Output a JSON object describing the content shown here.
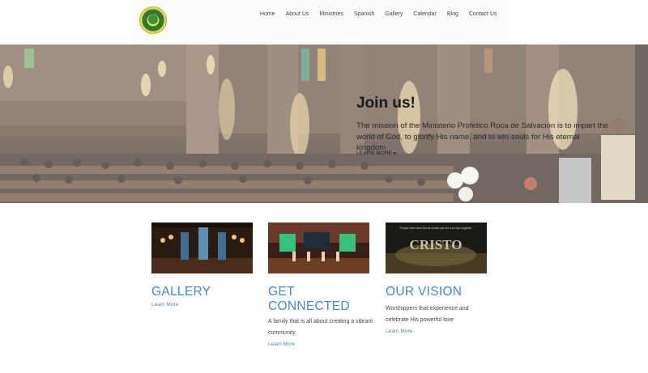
{
  "nav": {
    "items": [
      "Home",
      "About Us",
      "Ministries",
      "Spanish",
      "Gallery",
      "Calendar",
      "Blog",
      "Contact Us"
    ]
  },
  "hero": {
    "title": "Join us!",
    "text": "The mission of the Ministerio Profetico Roca de Salvacion is to impart the world of God, to glorify His name, and to win souls for His eternal kingdom",
    "link": "LEARN MORE ▸"
  },
  "cards": [
    {
      "title": "GALLERY",
      "text": "",
      "link": "Learn More"
    },
    {
      "title": "GET CONNECTED",
      "text": "A family that is all about creating a vibrant community",
      "link": "Learn More"
    },
    {
      "title": "OUR VISION",
      "text": "Worshippers that experience and celebrate His powerful love",
      "link": "Learn More"
    }
  ],
  "images": {
    "vision_banner_text": "CRISTO",
    "vision_banner_caption": "\"Porque tanto ama Dios al mundo que dio a su Hijo unigénito\""
  },
  "colors": {
    "accent": "#4b89b4",
    "header_bg": "#fcfcfb"
  }
}
